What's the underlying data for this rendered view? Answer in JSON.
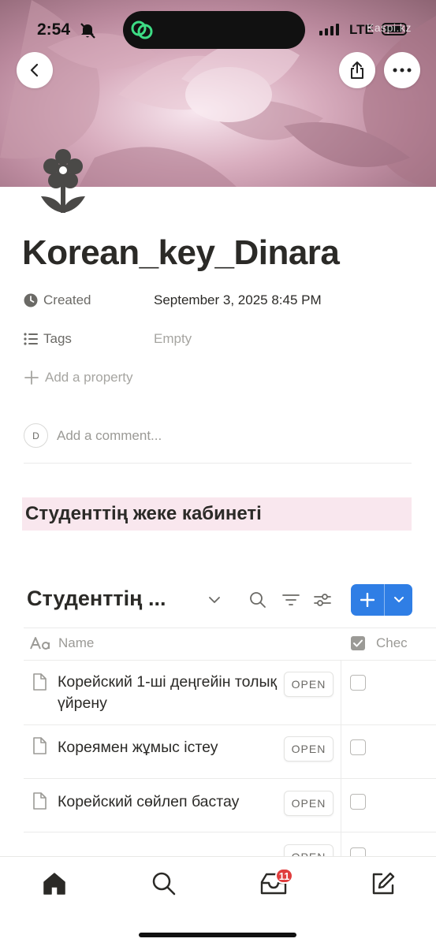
{
  "status_bar": {
    "time": "2:54",
    "network": "LTE",
    "watermark": "Kaspi.kz"
  },
  "page": {
    "title": "Korean_key_Dinara",
    "icon": "flower-icon"
  },
  "properties": {
    "created_label": "Created",
    "created_value": "September 3, 2025 8:45 PM",
    "tags_label": "Tags",
    "tags_value": "Empty",
    "add_property": "Add a property"
  },
  "comment": {
    "avatar_initial": "D",
    "placeholder": "Add a comment..."
  },
  "callout": {
    "text": "Студенттің жеке кабинеті"
  },
  "database": {
    "title": "Студенттің ...",
    "columns": {
      "name": "Name",
      "checkbox": "Chec"
    },
    "open_label": "OPEN",
    "rows": [
      {
        "name": "Корейский 1-ші деңгейін толық үйрену",
        "checked": false
      },
      {
        "name": "Кореямен жұмыс істеу",
        "checked": false
      },
      {
        "name": "Корейский сөйлеп бастау",
        "checked": false
      },
      {
        "name": "",
        "checked": false
      }
    ]
  },
  "bottom_nav": {
    "items": [
      "home-icon",
      "search-icon",
      "inbox-icon",
      "compose-icon"
    ],
    "inbox_badge": "11"
  },
  "colors": {
    "accent": "#2f7ee5",
    "callout_bg": "#f9e7ee",
    "badge": "#e03e3e"
  }
}
